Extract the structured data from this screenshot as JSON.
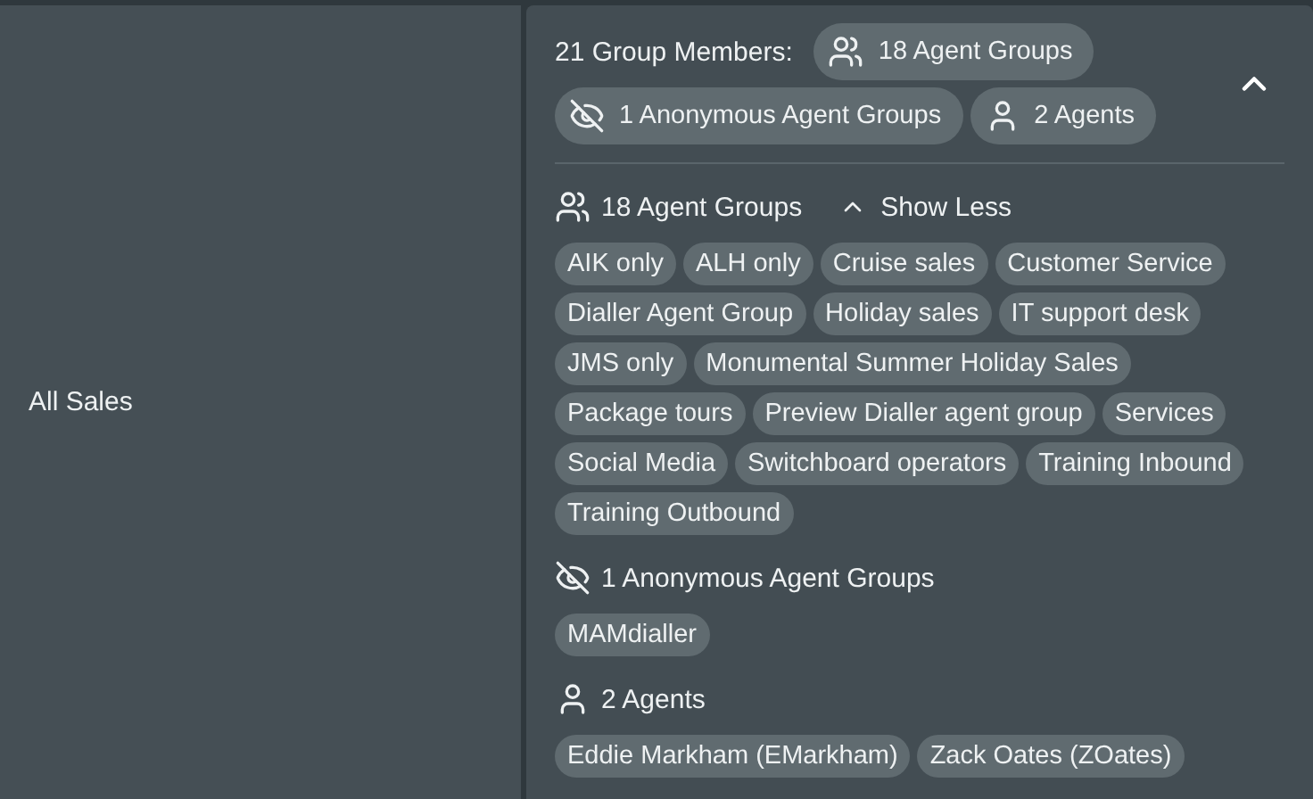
{
  "row": {
    "name": "All Sales"
  },
  "summary": {
    "label": "21 Group Members:",
    "expanded": true,
    "chips": [
      {
        "kind": "group",
        "label": "18 Agent Groups"
      },
      {
        "kind": "anonymous",
        "label": "1 Anonymous Agent Groups"
      },
      {
        "kind": "agent",
        "label": "2 Agents"
      }
    ]
  },
  "sections": [
    {
      "kind": "group",
      "title": "18 Agent Groups",
      "toggle": {
        "label": "Show Less",
        "expanded": true
      },
      "items": [
        "AIK only",
        "ALH only",
        "Cruise sales",
        "Customer Service",
        "Dialler Agent Group",
        "Holiday sales",
        "IT support desk",
        "JMS only",
        "Monumental Summer Holiday Sales",
        "Package tours",
        "Preview Dialler agent group",
        "Services",
        "Social Media",
        "Switchboard operators",
        "Training Inbound",
        "Training Outbound"
      ]
    },
    {
      "kind": "anonymous",
      "title": "1 Anonymous Agent Groups",
      "items": [
        "MAMdialler"
      ]
    },
    {
      "kind": "agent",
      "title": "2 Agents",
      "items": [
        "Eddie Markham (EMarkham)",
        "Zack Oates (ZOates)"
      ]
    }
  ]
}
